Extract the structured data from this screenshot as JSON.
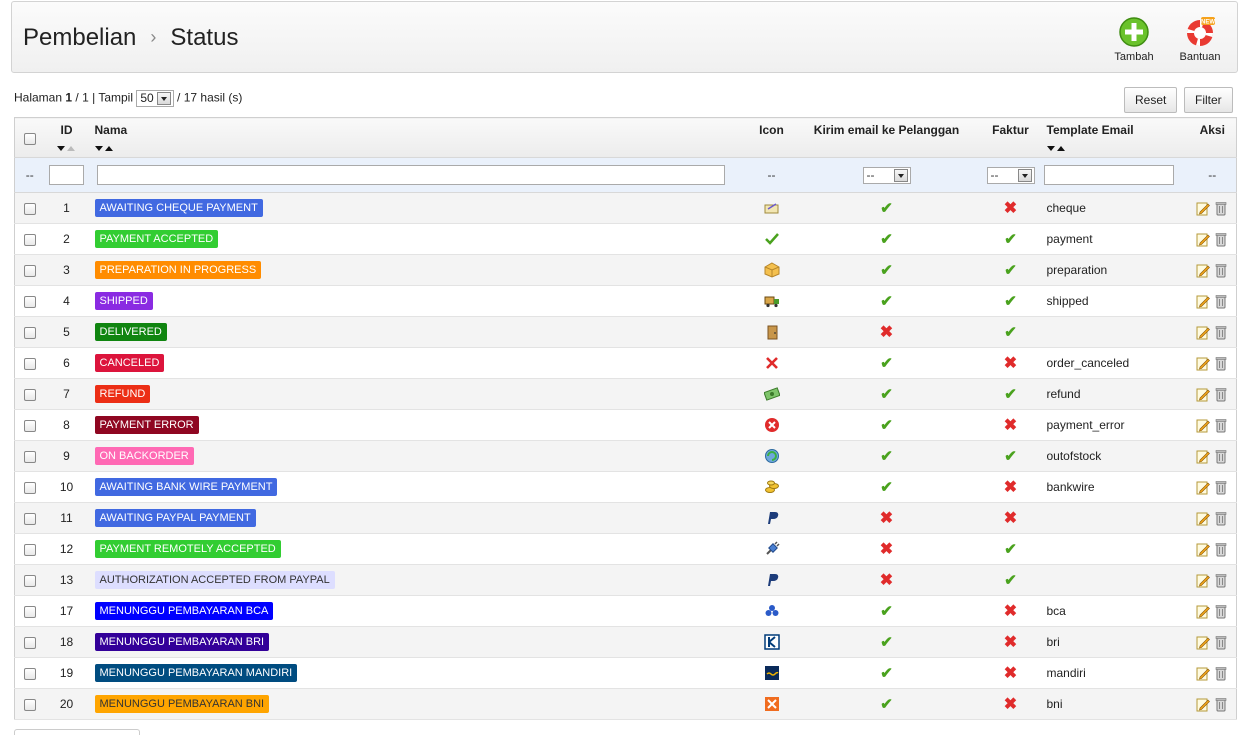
{
  "header": {
    "breadcrumb_parent": "Pembelian",
    "breadcrumb_separator": "›",
    "breadcrumb_current": "Status",
    "add_label": "Tambah",
    "help_label": "Bantuan",
    "help_badge": "NEW"
  },
  "pager": {
    "page_label": "Halaman",
    "page_current": "1",
    "page_total_text": "/ 1 | Tampil",
    "per_page": "50",
    "results_text": "/ 17 hasil (s)"
  },
  "buttons": {
    "reset": "Reset",
    "filter": "Filter"
  },
  "columns": {
    "id": "ID",
    "name": "Nama",
    "icon": "Icon",
    "send_email": "Kirim email ke Pelanggan",
    "invoice": "Faktur",
    "template": "Template Email",
    "actions": "Aksi"
  },
  "filters": {
    "checkbox_placeholder": "--",
    "icon_placeholder": "--",
    "send_email_value": "--",
    "invoice_value": "--",
    "actions_placeholder": "--"
  },
  "rows": [
    {
      "id": "1",
      "name": "AWAITING CHEQUE PAYMENT",
      "color": "#4169e1",
      "text_color": "#ffffff",
      "icon": "cheque-icon",
      "send_email": true,
      "invoice": false,
      "template": "cheque"
    },
    {
      "id": "2",
      "name": "PAYMENT ACCEPTED",
      "color": "#32cd32",
      "text_color": "#ffffff",
      "icon": "check-icon",
      "send_email": true,
      "invoice": true,
      "template": "payment"
    },
    {
      "id": "3",
      "name": "PREPARATION IN PROGRESS",
      "color": "#ff8c00",
      "text_color": "#ffffff",
      "icon": "package-icon",
      "send_email": true,
      "invoice": true,
      "template": "preparation"
    },
    {
      "id": "4",
      "name": "SHIPPED",
      "color": "#8a2be2",
      "text_color": "#ffffff",
      "icon": "truck-icon",
      "send_email": true,
      "invoice": true,
      "template": "shipped"
    },
    {
      "id": "5",
      "name": "DELIVERED",
      "color": "#108510",
      "text_color": "#ffffff",
      "icon": "door-icon",
      "send_email": false,
      "invoice": true,
      "template": ""
    },
    {
      "id": "6",
      "name": "CANCELED",
      "color": "#dc143c",
      "text_color": "#ffffff",
      "icon": "cross-icon",
      "send_email": true,
      "invoice": false,
      "template": "order_canceled"
    },
    {
      "id": "7",
      "name": "REFUND",
      "color": "#ec2e15",
      "text_color": "#ffffff",
      "icon": "money-icon",
      "send_email": true,
      "invoice": true,
      "template": "refund"
    },
    {
      "id": "8",
      "name": "PAYMENT ERROR",
      "color": "#8f0621",
      "text_color": "#ffffff",
      "icon": "error-icon",
      "send_email": true,
      "invoice": false,
      "template": "payment_error"
    },
    {
      "id": "9",
      "name": "ON BACKORDER",
      "color": "#ff69b4",
      "text_color": "#ffffff",
      "icon": "refresh-icon",
      "send_email": true,
      "invoice": true,
      "template": "outofstock"
    },
    {
      "id": "10",
      "name": "AWAITING BANK WIRE PAYMENT",
      "color": "#4169e1",
      "text_color": "#ffffff",
      "icon": "coins-icon",
      "send_email": true,
      "invoice": false,
      "template": "bankwire"
    },
    {
      "id": "11",
      "name": "AWAITING PAYPAL PAYMENT",
      "color": "#4169e1",
      "text_color": "#ffffff",
      "icon": "paypal-icon",
      "send_email": false,
      "invoice": false,
      "template": ""
    },
    {
      "id": "12",
      "name": "PAYMENT REMOTELY ACCEPTED",
      "color": "#32cd32",
      "text_color": "#ffffff",
      "icon": "plug-icon",
      "send_email": false,
      "invoice": true,
      "template": ""
    },
    {
      "id": "13",
      "name": "AUTHORIZATION ACCEPTED FROM PAYPAL",
      "color": "#dddeff",
      "text_color": "#333333",
      "icon": "paypal-icon",
      "send_email": false,
      "invoice": true,
      "template": ""
    },
    {
      "id": "17",
      "name": "MENUNGGU PEMBAYARAN BCA",
      "color": "#0000ff",
      "text_color": "#ffffff",
      "icon": "bca-icon",
      "send_email": true,
      "invoice": false,
      "template": "bca"
    },
    {
      "id": "18",
      "name": "MENUNGGU PEMBAYARAN BRI",
      "color": "#330099",
      "text_color": "#ffffff",
      "icon": "bri-icon",
      "send_email": true,
      "invoice": false,
      "template": "bri"
    },
    {
      "id": "19",
      "name": "MENUNGGU PEMBAYARAN MANDIRI",
      "color": "#004c80",
      "text_color": "#ffffff",
      "icon": "mandiri-icon",
      "send_email": true,
      "invoice": false,
      "template": "mandiri"
    },
    {
      "id": "20",
      "name": "MENUNGGU PEMBAYARAN BNI",
      "color": "#ffa500",
      "text_color": "#333333",
      "icon": "bni-icon",
      "send_email": true,
      "invoice": false,
      "template": "bni"
    }
  ],
  "colors": {
    "check": "#4aa21e",
    "cross": "#e02b2b",
    "filter_row": "#eaf1fb"
  }
}
